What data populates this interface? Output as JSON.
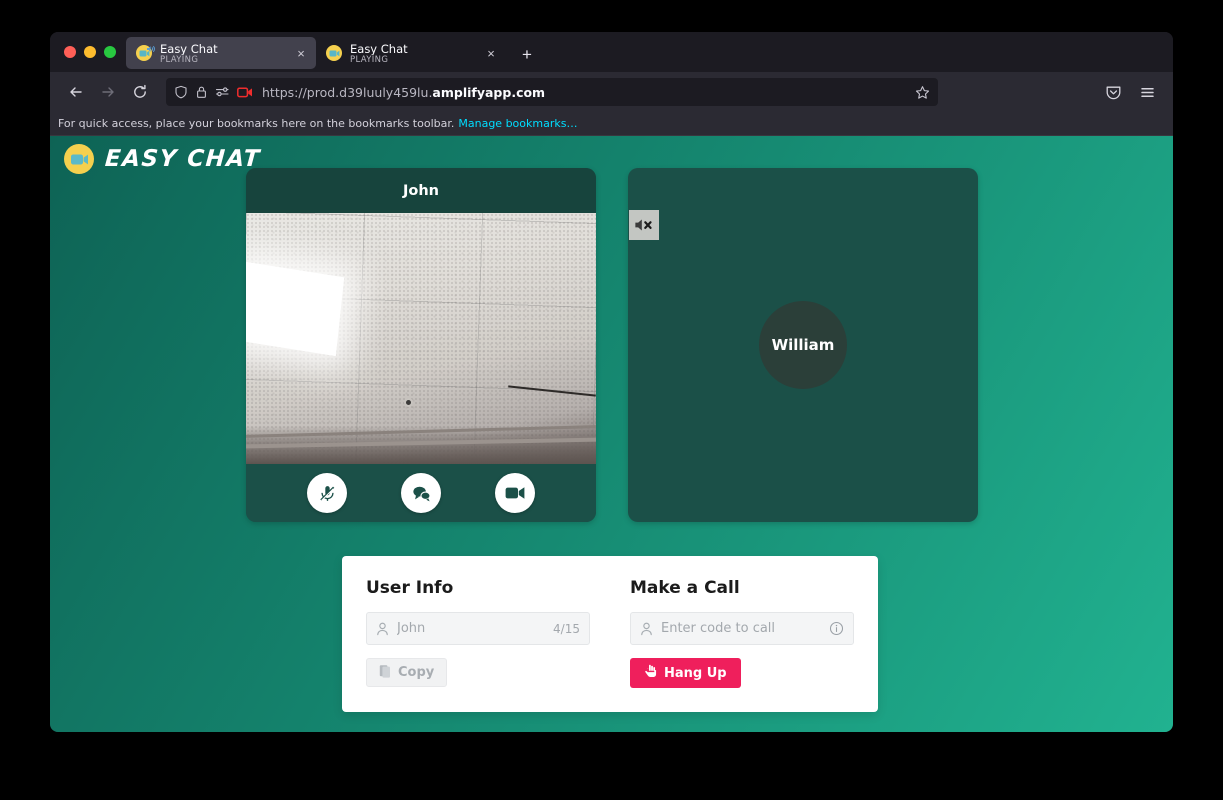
{
  "browser": {
    "tabs": [
      {
        "title": "Easy Chat",
        "status": "PLAYING",
        "active": true,
        "audio": "speaker-playing-icon"
      },
      {
        "title": "Easy Chat",
        "status": "PLAYING",
        "active": false,
        "audio": null
      }
    ],
    "new_tab_label": "+",
    "close_label": "×",
    "url": {
      "prefix": "https://prod.d39luuly459lu.",
      "domain": "amplifyapp.com"
    },
    "bookmarks_text": "For quick access, place your bookmarks here on the bookmarks toolbar.",
    "bookmarks_link": "Manage bookmarks…",
    "icons": {
      "back": "back-arrow-icon",
      "forward": "forward-arrow-icon",
      "reload": "reload-icon",
      "shield": "shield-icon",
      "lock": "lock-icon",
      "permissions": "permissions-icon",
      "camera": "camera-sharing-icon",
      "bookmark_star": "star-icon",
      "pocket": "pocket-icon",
      "menu": "hamburger-menu-icon"
    }
  },
  "app": {
    "brand": "EASY CHAT",
    "logo_icon": "video-camera-logo-icon",
    "local_video": {
      "name": "John",
      "controls": [
        {
          "name": "mic-muted-icon",
          "label": "Toggle microphone"
        },
        {
          "name": "chat-bubbles-icon",
          "label": "Open chat"
        },
        {
          "name": "video-camera-icon",
          "label": "Toggle camera"
        }
      ]
    },
    "remote_video": {
      "name": "William",
      "mute_indicator_icon": "speaker-muted-icon"
    },
    "panel": {
      "user_info": {
        "title": "User Info",
        "field_icon": "person-icon",
        "field_value": "John",
        "field_counter": "4/15",
        "copy_button": "Copy",
        "copy_icon": "clipboard-icon"
      },
      "make_a_call": {
        "title": "Make a Call",
        "field_icon": "person-icon",
        "field_placeholder": "Enter code to call",
        "info_icon": "info-circle-icon",
        "hangup_button": "Hang Up",
        "hangup_icon": "hand-icon"
      }
    },
    "colors": {
      "bg_from": "#0e6355",
      "bg_to": "#21b290",
      "card": "#1b5048",
      "card_header": "#17443d",
      "accent_pink": "#ef1f5c",
      "logo_yellow": "#f5d04e"
    }
  }
}
